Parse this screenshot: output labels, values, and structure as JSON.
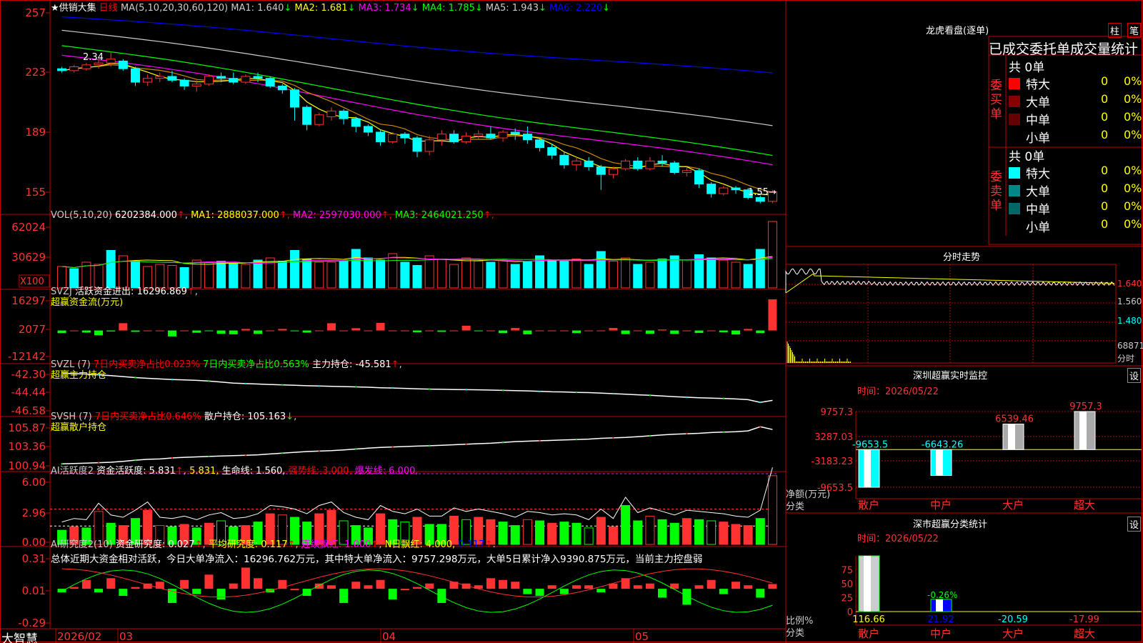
{
  "app": {
    "logo": "大智慧"
  },
  "colors": {
    "up": "#ff3232",
    "down": "#00ffff",
    "ma1": "#ffff00",
    "ma2": "#ff00ff",
    "ma3": "#00ff00",
    "ma4": "#cccccc",
    "ma5": "#0000ff",
    "grid": "#800000",
    "frame": "#c00000",
    "vol_up": "#ff3232",
    "vol_down": "#00ffff"
  },
  "main": {
    "title": "★供销大集",
    "period": "日线",
    "ma_label": "MA(5,10,20,30,60,120)",
    "ma": [
      {
        "name": "MA1:",
        "value": "1.640",
        "arrow": "↓"
      },
      {
        "name": "MA2:",
        "value": "1.681",
        "arrow": "↓"
      },
      {
        "name": "MA3:",
        "value": "1.734",
        "arrow": "↓"
      },
      {
        "name": "MA4:",
        "value": "1.785",
        "arrow": "↓"
      },
      {
        "name": "MA5:",
        "value": "1.943",
        "arrow": "↓"
      },
      {
        "name": "MA6:",
        "value": "2.220",
        "arrow": "↓"
      }
    ],
    "y_ticks": [
      "257",
      "223",
      "189",
      "155"
    ],
    "high_label": "2.34",
    "low_label": "1.55"
  },
  "vol": {
    "label": "VOL(5,10,20)",
    "value": "6202384.000",
    "ma": [
      {
        "name": "MA1:",
        "value": "2888037.000"
      },
      {
        "name": "MA2:",
        "value": "2597030.000"
      },
      {
        "name": "MA3:",
        "value": "2464021.250"
      }
    ],
    "y_ticks": [
      "62024",
      "30629"
    ],
    "unit": "X100"
  },
  "svzj": {
    "label": "SVZJ",
    "text": "活跃资金进出:",
    "value": "16296.869",
    "subtitle": "超赢资金流(万元)",
    "y_ticks": [
      "16297",
      "2077",
      "-12142"
    ]
  },
  "svzl": {
    "label": "SVZL (7)",
    "text1": "7日内买卖净占比0.023%",
    "text2": "7日内买卖净占比0.563%",
    "text3": "主力持仓:",
    "value": "-45.581",
    "subtitle": "超赢主力持仓",
    "y_ticks": [
      "-42.30",
      "-44.44",
      "-46.58"
    ]
  },
  "svsh": {
    "label": "SVSH (7)",
    "text1": "7日内买卖净占比0.646%",
    "text2": "散户持仓:",
    "value": "105.163",
    "subtitle": "超赢散户持仓",
    "y_ticks": [
      "105.87",
      "103.36",
      "100.94"
    ]
  },
  "ai1": {
    "label": "AI活跃度2",
    "text1": "资金活跃度:",
    "v1": "5.831",
    "v2": "5.831,",
    "t2": "生命线:",
    "v3": "1.560,",
    "t3": "强势线:",
    "v4": "3.000,",
    "t4": "爆发线:",
    "v5": "6.000,",
    "y_ticks": [
      "6.00",
      "2.96",
      "0.00"
    ]
  },
  "ai2": {
    "label": "AI研究度2(10)",
    "t1": "资金研究度:",
    "v1": "0.027",
    "t2": "平均研究度:",
    "v2": "0.117",
    "t3": "连续飘红:",
    "v3": "1.000",
    "t4": "N日飘红:",
    "v4": "4.000,",
    "v5": "0.117",
    "summary": "总体近期大资金相对活跃，今日大单净流入：16296.762万元，其中特大单净流入：9757.298万元，大单5日累计净入9390.875万元，当前主力控盘弱",
    "y_ticks": [
      "0.31",
      "0.01",
      "-0.29"
    ]
  },
  "xaxis": {
    "labels": [
      "2026/02",
      "03",
      "04",
      "05"
    ]
  },
  "right": {
    "lhkp": {
      "title": "龙虎看盘(逐单)",
      "btn1": "柱",
      "btn2": "笔",
      "subtitle": "已成交委托单成交量统计",
      "buy_label": "委买单",
      "sell_label": "委卖单",
      "buy_total": "共 0单",
      "sell_total": "共 0单",
      "buy_rows": [
        {
          "label": "特大",
          "count": "0",
          "pct": "0%"
        },
        {
          "label": "大单",
          "count": "0",
          "pct": "0%"
        },
        {
          "label": "中单",
          "count": "0",
          "pct": "0%"
        },
        {
          "label": "小单",
          "count": "0",
          "pct": "0%"
        }
      ],
      "sell_rows": [
        {
          "label": "特大",
          "count": "0",
          "pct": "0%"
        },
        {
          "label": "大单",
          "count": "0",
          "pct": "0%"
        },
        {
          "label": "中单",
          "count": "0",
          "pct": "0%"
        },
        {
          "label": "小单",
          "count": "0",
          "pct": "0%"
        }
      ]
    },
    "fsz": {
      "title": "分时走势",
      "labels": [
        "1.640",
        "1.560",
        "1.480",
        "68871",
        "分时"
      ]
    },
    "szcy": {
      "title": "深圳超赢实时监控",
      "btn": "设",
      "time": "时间：2026/05/22",
      "y_ticks": [
        "9757.3",
        "3287.03",
        "-3183.23",
        "-9653.5"
      ],
      "axis_label1": "净额(万元)",
      "axis_label2": "分类",
      "categories": [
        "散户",
        "中户",
        "大户",
        "超大"
      ],
      "values": [
        -9653.5,
        -6643.26,
        6539.46,
        9757.3
      ],
      "value_labels": [
        "-9653.5",
        "-6643.26",
        "6539.46",
        "9757.3"
      ]
    },
    "scfl": {
      "title": "深市超赢分类统计",
      "btn": "设",
      "time": "时间：2026/05/22",
      "y_ticks": [
        "75",
        "50",
        "25",
        "0"
      ],
      "axis_label1": "比例%",
      "axis_label2": "分类",
      "categories": [
        "散户",
        "中户",
        "大户",
        "超大"
      ],
      "values": [
        116.66,
        21.92,
        -20.59,
        -17.99
      ],
      "value_labels": [
        "116.66",
        "21.92",
        "-20.59",
        "-17.99"
      ],
      "note": "-0.26%"
    }
  },
  "chart_data": [
    {
      "type": "candlestick",
      "title": "供销大集 日线",
      "x_start": "2026/02",
      "x_markers": [
        "2026/02",
        "03",
        "04",
        "05"
      ],
      "ohlc": [
        [
          2.25,
          2.26,
          2.23,
          2.24
        ],
        [
          2.24,
          2.27,
          2.23,
          2.26
        ],
        [
          2.25,
          2.28,
          2.24,
          2.27
        ],
        [
          2.27,
          2.3,
          2.25,
          2.28
        ],
        [
          2.28,
          2.34,
          2.26,
          2.3
        ],
        [
          2.29,
          2.3,
          2.24,
          2.25
        ],
        [
          2.25,
          2.26,
          2.16,
          2.18
        ],
        [
          2.18,
          2.22,
          2.16,
          2.2
        ],
        [
          2.2,
          2.23,
          2.18,
          2.21
        ],
        [
          2.21,
          2.24,
          2.18,
          2.19
        ],
        [
          2.19,
          2.2,
          2.14,
          2.16
        ],
        [
          2.16,
          2.19,
          2.13,
          2.17
        ],
        [
          2.17,
          2.22,
          2.16,
          2.21
        ],
        [
          2.21,
          2.23,
          2.18,
          2.2
        ],
        [
          2.2,
          2.23,
          2.17,
          2.18
        ],
        [
          2.18,
          2.22,
          2.17,
          2.21
        ],
        [
          2.21,
          2.23,
          2.18,
          2.2
        ],
        [
          2.2,
          2.21,
          2.15,
          2.16
        ],
        [
          2.16,
          2.17,
          2.12,
          2.14
        ],
        [
          2.14,
          2.15,
          1.98,
          2.05
        ],
        [
          2.05,
          2.06,
          1.93,
          1.96
        ],
        [
          1.96,
          2.02,
          1.95,
          2.01
        ],
        [
          2.0,
          2.05,
          1.98,
          2.03
        ],
        [
          2.03,
          2.04,
          1.96,
          1.99
        ],
        [
          1.99,
          2.0,
          1.92,
          1.95
        ],
        [
          1.95,
          1.96,
          1.9,
          1.92
        ],
        [
          1.92,
          1.93,
          1.85,
          1.87
        ],
        [
          1.87,
          1.92,
          1.86,
          1.91
        ],
        [
          1.91,
          1.92,
          1.86,
          1.89
        ],
        [
          1.89,
          1.9,
          1.79,
          1.82
        ],
        [
          1.82,
          1.9,
          1.8,
          1.88
        ],
        [
          1.88,
          1.93,
          1.85,
          1.91
        ],
        [
          1.91,
          1.93,
          1.86,
          1.87
        ],
        [
          1.87,
          1.92,
          1.86,
          1.9
        ],
        [
          1.9,
          1.93,
          1.88,
          1.91
        ],
        [
          1.91,
          1.95,
          1.88,
          1.89
        ],
        [
          1.89,
          1.93,
          1.87,
          1.92
        ],
        [
          1.92,
          1.94,
          1.88,
          1.91
        ],
        [
          1.91,
          1.95,
          1.86,
          1.88
        ],
        [
          1.88,
          1.89,
          1.82,
          1.84
        ],
        [
          1.84,
          1.86,
          1.78,
          1.8
        ],
        [
          1.8,
          1.82,
          1.73,
          1.75
        ],
        [
          1.75,
          1.79,
          1.72,
          1.77
        ],
        [
          1.77,
          1.79,
          1.72,
          1.74
        ],
        [
          1.74,
          1.75,
          1.62,
          1.7
        ],
        [
          1.7,
          1.74,
          1.68,
          1.73
        ],
        [
          1.73,
          1.78,
          1.72,
          1.77
        ],
        [
          1.77,
          1.79,
          1.72,
          1.73
        ],
        [
          1.73,
          1.79,
          1.72,
          1.77
        ],
        [
          1.77,
          1.8,
          1.74,
          1.76
        ],
        [
          1.76,
          1.77,
          1.7,
          1.71
        ],
        [
          1.71,
          1.74,
          1.69,
          1.72
        ],
        [
          1.72,
          1.73,
          1.63,
          1.65
        ],
        [
          1.65,
          1.66,
          1.58,
          1.6
        ],
        [
          1.6,
          1.64,
          1.59,
          1.63
        ],
        [
          1.63,
          1.64,
          1.6,
          1.62
        ],
        [
          1.62,
          1.63,
          1.57,
          1.58
        ],
        [
          1.58,
          1.59,
          1.55,
          1.56
        ],
        [
          1.56,
          1.62,
          1.55,
          1.61
        ]
      ],
      "ma": {
        "MA1": 1.64,
        "MA2": 1.681,
        "MA3": 1.734,
        "MA4": 1.785,
        "MA5": 1.943,
        "MA6": 2.22
      },
      "ylim": [
        1.5,
        2.6
      ]
    },
    {
      "type": "bar",
      "title": "VOL",
      "values": [
        20,
        18,
        24,
        22,
        35,
        30,
        25,
        20,
        22,
        21,
        19,
        26,
        24,
        25,
        23,
        22,
        26,
        28,
        25,
        35,
        27,
        24,
        24,
        25,
        36,
        28,
        26,
        32,
        24,
        21,
        30,
        27,
        22,
        28,
        25,
        24,
        26,
        22,
        25,
        30,
        26,
        25,
        27,
        22,
        34,
        25,
        28,
        22,
        24,
        27,
        30,
        26,
        31,
        28,
        26,
        24,
        22,
        36,
        62
      ],
      "up": [
        1,
        0,
        1,
        1,
        0,
        1,
        0,
        1,
        1,
        1,
        0,
        1,
        1,
        0,
        0,
        1,
        0,
        1,
        0,
        0,
        0,
        1,
        1,
        0,
        0,
        0,
        0,
        1,
        0,
        0,
        1,
        1,
        1,
        1,
        1,
        0,
        1,
        0,
        0,
        0,
        0,
        0,
        1,
        0,
        0,
        1,
        1,
        0,
        1,
        0,
        0,
        1,
        0,
        0,
        1,
        1,
        0,
        0,
        1
      ],
      "ylim": [
        0,
        65000
      ]
    },
    {
      "type": "bar",
      "title": "超赢资金流(万元)",
      "values": [
        -1400,
        0,
        -1100,
        -2500,
        -500,
        3800,
        -700,
        0,
        0,
        -3100,
        0,
        -1200,
        -200,
        -1700,
        -2000,
        800,
        -1800,
        0,
        800,
        -400,
        -1100,
        0,
        3800,
        0,
        1200,
        0,
        4000,
        0,
        0,
        -900,
        0,
        -700,
        0,
        2500,
        -400,
        0,
        -1400,
        1300,
        -2000,
        0,
        0,
        0,
        -1400,
        0,
        0,
        1300,
        -1900,
        0,
        -1700,
        500,
        -1800,
        0,
        -1300,
        0,
        -900,
        -2100,
        800,
        -1400,
        16297
      ],
      "ylim": [
        -12142,
        16297
      ]
    },
    {
      "type": "line",
      "title": "超赢主力持仓",
      "values": [
        -42.55,
        -42.62,
        -42.66,
        -42.74,
        -42.83,
        -42.94,
        -43.05,
        -43.13,
        -43.2,
        -43.27,
        -43.31,
        -43.36,
        -43.44,
        -43.55,
        -43.66,
        -43.72,
        -43.77,
        -43.82,
        -43.86,
        -43.91,
        -43.96,
        -43.99,
        -44.02,
        -44.05,
        -44.08,
        -44.12,
        -44.18,
        -44.21,
        -44.25,
        -44.3,
        -44.33,
        -44.35,
        -44.38,
        -44.39,
        -44.41,
        -44.44,
        -44.47,
        -44.5,
        -44.53,
        -44.58,
        -44.63,
        -44.65,
        -44.69,
        -44.72,
        -44.77,
        -44.84,
        -44.9,
        -44.96,
        -45.02,
        -45.1,
        -45.18,
        -45.23,
        -45.29,
        -45.33,
        -45.37,
        -45.42,
        -45.5,
        -45.8,
        -45.58
      ],
      "ylim": [
        -46.58,
        -42.3
      ]
    },
    {
      "type": "line",
      "title": "超赢散户持仓",
      "values": [
        101.0,
        101.05,
        101.1,
        101.15,
        101.2,
        101.3,
        101.45,
        101.55,
        101.6,
        101.72,
        101.8,
        101.85,
        101.9,
        101.95,
        102.0,
        102.05,
        102.1,
        102.2,
        102.3,
        102.4,
        102.5,
        102.55,
        102.6,
        102.7,
        102.8,
        102.9,
        103.0,
        103.05,
        103.1,
        103.15,
        103.2,
        103.25,
        103.32,
        103.38,
        103.45,
        103.5,
        103.6,
        103.7,
        103.75,
        103.8,
        103.85,
        103.9,
        103.95,
        104.0,
        104.1,
        104.15,
        104.2,
        104.3,
        104.4,
        104.5,
        104.6,
        104.65,
        104.7,
        104.8,
        104.85,
        104.9,
        105.0,
        105.5,
        105.16
      ],
      "ylim": [
        100.94,
        105.87
      ]
    },
    {
      "type": "bar",
      "title": "AI活跃度2",
      "values": [
        1.2,
        1.5,
        1.4,
        2.8,
        1.8,
        1.6,
        2.2,
        2.9,
        1.6,
        1.5,
        1.7,
        1.4,
        1.8,
        2.0,
        1.5,
        1.6,
        1.9,
        2.6,
        2.5,
        2.3,
        1.9,
        2.6,
        2.9,
        2.0,
        1.6,
        1.4,
        2.6,
        2.1,
        1.9,
        2.3,
        1.7,
        1.7,
        2.4,
        2.1,
        2.3,
        2.1,
        1.9,
        1.6,
        2.1,
        2.0,
        1.8,
        1.9,
        1.8,
        1.4,
        2.3,
        1.5,
        3.3,
        2.0,
        2.4,
        2.1,
        1.8,
        2.2,
        2.1,
        2.0,
        1.9,
        1.7,
        1.6,
        2.2,
        5.83
      ],
      "up": [
        0,
        1,
        0,
        1,
        0,
        1,
        0,
        1,
        1,
        0,
        1,
        0,
        1,
        0,
        0,
        1,
        0,
        1,
        1,
        0,
        0,
        1,
        1,
        0,
        0,
        0,
        1,
        0,
        0,
        1,
        0,
        0,
        1,
        0,
        1,
        1,
        0,
        0,
        1,
        0,
        1,
        0,
        0,
        0,
        1,
        1,
        0,
        0,
        1,
        0,
        0,
        1,
        0,
        0,
        1,
        1,
        1,
        0,
        1
      ],
      "ylim": [
        0,
        6.0
      ]
    },
    {
      "type": "bar",
      "title": "AI研究度2(10)",
      "values": [
        -0.02,
        0.01,
        0.05,
        -0.02,
        0.06,
        -0.04,
        0.01,
        0.03,
        0.04,
        -0.08,
        0.05,
        -0.03,
        0.08,
        -0.06,
        0.03,
        0.12,
        0.06,
        -0.02,
        0.05,
        0.0,
        -0.04,
        0.03,
        0.02,
        -0.08,
        0.04,
        0.02,
        0.05,
        -0.06,
        0.0,
        0.01,
        0.03,
        -0.08,
        0.04,
        0.03,
        0.02,
        0.06,
        0.05,
        0.04,
        -0.03,
        -0.04,
        0.02,
        -0.03,
        0.02,
        0.02,
        -0.02,
        0.03,
        0.06,
        0.02,
        0.03,
        -0.05,
        0.03,
        -0.09,
        0.02,
        0.05,
        -0.03,
        0.04,
        0.02,
        -0.05,
        0.027
      ],
      "ylim": [
        -0.29,
        0.31
      ]
    }
  ]
}
